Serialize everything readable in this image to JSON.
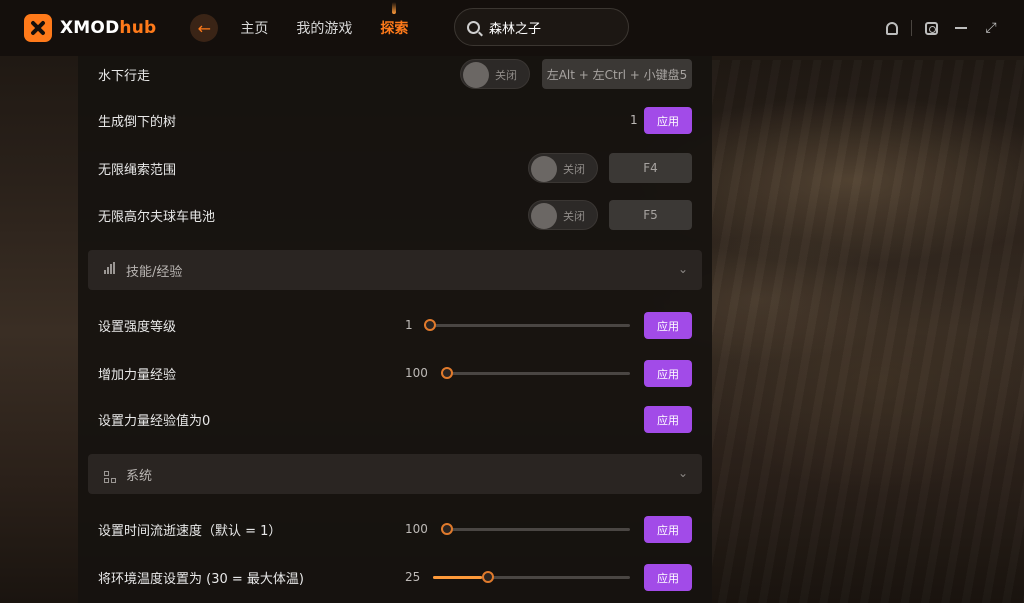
{
  "app": {
    "brand_x": "XMOD",
    "brand_hub": "hub"
  },
  "nav": {
    "home": "主页",
    "my_games": "我的游戏",
    "explore": "探索"
  },
  "search": {
    "value": "森林之子"
  },
  "rows": {
    "underwater_walk": {
      "label": "水下行走",
      "toggle": "关闭",
      "hotkey": "左Alt + 左Ctrl + 小键盘5"
    },
    "spawn_tree": {
      "label": "生成倒下的树",
      "value": "1",
      "apply": "应用"
    },
    "infinite_rope": {
      "label": "无限绳索范围",
      "toggle": "关闭",
      "hotkey": "F4"
    },
    "golf_battery": {
      "label": "无限高尔夫球车电池",
      "toggle": "关闭",
      "hotkey": "F5"
    }
  },
  "sections": {
    "skills": {
      "title": "技能/经验"
    },
    "system": {
      "title": "系统"
    }
  },
  "skills": {
    "strength_level": {
      "label": "设置强度等级",
      "value": "1",
      "apply": "应用",
      "fraction": 0.0
    },
    "add_strength_xp": {
      "label": "增加力量经验",
      "value": "100",
      "apply": "应用",
      "fraction": 0.0
    },
    "reset_strength_xp": {
      "label": "设置力量经验值为0",
      "apply": "应用"
    }
  },
  "system": {
    "time_speed": {
      "label": "设置时间流逝速度（默认 = 1）",
      "value": "100",
      "apply": "应用",
      "fraction": 0.0
    },
    "env_temp": {
      "label": "将环境温度设置为 (30 = 最大体温)",
      "value": "25",
      "apply": "应用",
      "fraction": 0.25
    }
  },
  "colors": {
    "accent": "#ff7a1a",
    "apply": "#a24be8",
    "slider_fill": "#ff9a3a"
  },
  "icons": {
    "back": "arrow-left-icon",
    "search": "search-icon",
    "notify": "bell-icon",
    "settings": "gear-hex-icon",
    "minimize": "minimize-icon",
    "close": "shrink-icon",
    "skills": "bar-chart-icon",
    "system": "grid-plus-icon",
    "chevron": "chevron-down-icon"
  }
}
